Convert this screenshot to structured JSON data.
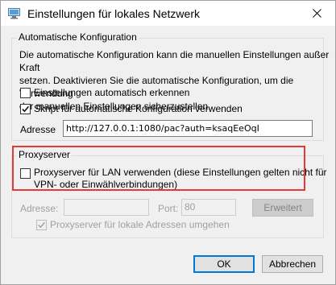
{
  "window": {
    "title": "Einstellungen für lokales Netzwerk",
    "icon": "network-settings-icon",
    "close_icon": "close-icon"
  },
  "auto_config": {
    "legend": "Automatische Konfiguration",
    "description_lines": [
      "Die automatische Konfiguration kann die manuellen Einstellungen außer Kraft",
      "setzen. Deaktivieren Sie die automatische Konfiguration, um die Verwendung",
      "der manuellen Einstellungen sicherzustellen."
    ],
    "detect_automatically": {
      "label": "Einstellungen automatisch erkennen",
      "checked": false
    },
    "use_script": {
      "label": "Skript für automatische Konfiguration verwenden",
      "checked": true
    },
    "address_label": "Adresse",
    "address_value": "http://127.0.0.1:1080/pac?auth=ksaqEeOqI"
  },
  "proxy": {
    "legend": "Proxyserver",
    "use_proxy": {
      "label_line1": "Proxyserver für LAN verwenden (diese Einstellungen gelten nicht für",
      "label_line2": "VPN- oder Einwählverbindungen)",
      "checked": false
    },
    "address_label": "Adresse:",
    "address_value": "",
    "port_label": "Port:",
    "port_value": "80",
    "advanced_button": "Erweitert",
    "bypass_local": {
      "label": "Proxyserver für lokale Adressen umgehen",
      "checked": true,
      "enabled": false
    }
  },
  "buttons": {
    "ok": "OK",
    "cancel": "Abbrechen"
  },
  "colors": {
    "highlight": "#e53935",
    "default_button_border": "#0078d7"
  }
}
